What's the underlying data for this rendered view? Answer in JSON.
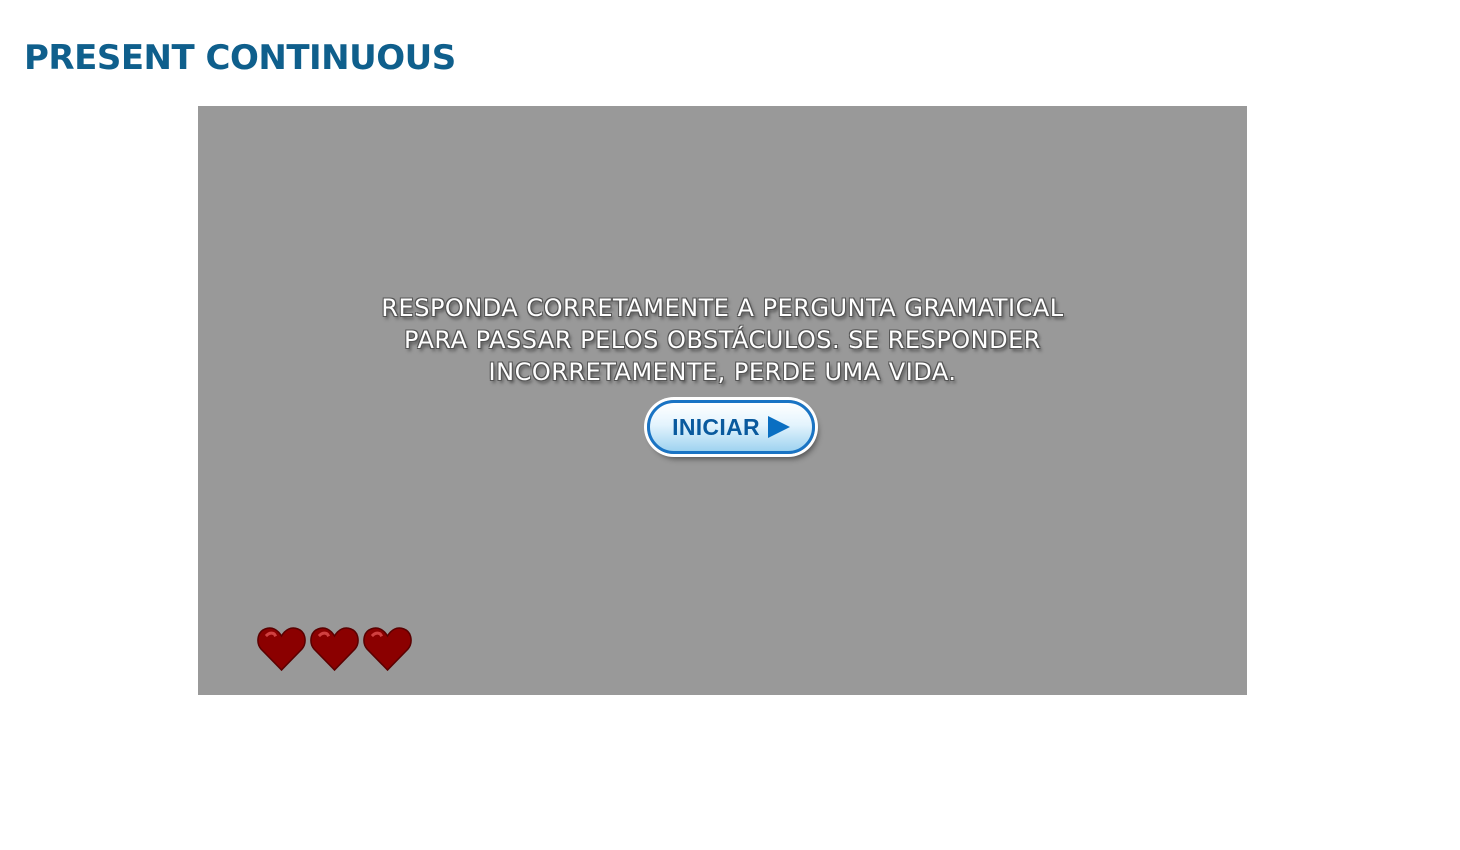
{
  "page": {
    "title": "PRESENT CONTINUOUS"
  },
  "game": {
    "instructions": {
      "lines": [
        "RESPONDA CORRETAMENTE A PERGUNTA GRAMATICAL",
        "PARA PASSAR PELOS OBSTÁCULOS. SE RESPONDER",
        "INCORRETAMENTE, PERDE UMA VIDA."
      ]
    },
    "start_button": {
      "label": "INICIAR",
      "icon": "play-arrow-icon"
    },
    "lives": {
      "count": 3,
      "icon": "heart-icon"
    }
  },
  "colors": {
    "title": "#0f5f8c",
    "stage_background": "#999999",
    "heart": "#8b0000",
    "button_border": "#1a74c4",
    "button_text": "#0a5a9e"
  }
}
